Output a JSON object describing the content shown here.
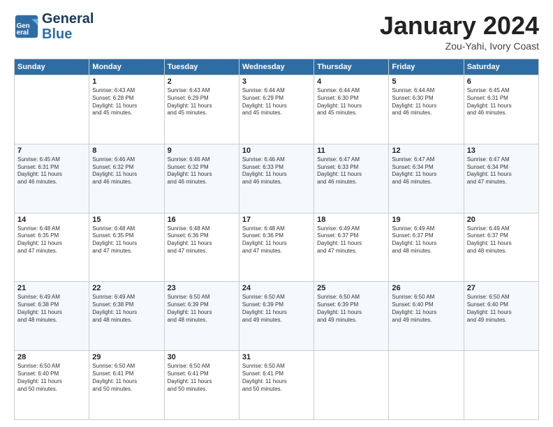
{
  "header": {
    "logo_line1": "General",
    "logo_line2": "Blue",
    "month": "January 2024",
    "location": "Zou-Yahi, Ivory Coast"
  },
  "weekdays": [
    "Sunday",
    "Monday",
    "Tuesday",
    "Wednesday",
    "Thursday",
    "Friday",
    "Saturday"
  ],
  "weeks": [
    [
      {
        "day": "",
        "content": ""
      },
      {
        "day": "1",
        "content": "Sunrise: 6:43 AM\nSunset: 6:28 PM\nDaylight: 11 hours\nand 45 minutes."
      },
      {
        "day": "2",
        "content": "Sunrise: 6:43 AM\nSunset: 6:29 PM\nDaylight: 11 hours\nand 45 minutes."
      },
      {
        "day": "3",
        "content": "Sunrise: 6:44 AM\nSunset: 6:29 PM\nDaylight: 11 hours\nand 45 minutes."
      },
      {
        "day": "4",
        "content": "Sunrise: 6:44 AM\nSunset: 6:30 PM\nDaylight: 11 hours\nand 45 minutes."
      },
      {
        "day": "5",
        "content": "Sunrise: 6:44 AM\nSunset: 6:30 PM\nDaylight: 11 hours\nand 46 minutes."
      },
      {
        "day": "6",
        "content": "Sunrise: 6:45 AM\nSunset: 6:31 PM\nDaylight: 11 hours\nand 46 minutes."
      }
    ],
    [
      {
        "day": "7",
        "content": "Sunrise: 6:45 AM\nSunset: 6:31 PM\nDaylight: 11 hours\nand 46 minutes."
      },
      {
        "day": "8",
        "content": "Sunrise: 6:46 AM\nSunset: 6:32 PM\nDaylight: 11 hours\nand 46 minutes."
      },
      {
        "day": "9",
        "content": "Sunrise: 6:46 AM\nSunset: 6:32 PM\nDaylight: 11 hours\nand 46 minutes."
      },
      {
        "day": "10",
        "content": "Sunrise: 6:46 AM\nSunset: 6:33 PM\nDaylight: 11 hours\nand 46 minutes."
      },
      {
        "day": "11",
        "content": "Sunrise: 6:47 AM\nSunset: 6:33 PM\nDaylight: 11 hours\nand 46 minutes."
      },
      {
        "day": "12",
        "content": "Sunrise: 6:47 AM\nSunset: 6:34 PM\nDaylight: 11 hours\nand 46 minutes."
      },
      {
        "day": "13",
        "content": "Sunrise: 6:47 AM\nSunset: 6:34 PM\nDaylight: 11 hours\nand 47 minutes."
      }
    ],
    [
      {
        "day": "14",
        "content": "Sunrise: 6:48 AM\nSunset: 6:35 PM\nDaylight: 11 hours\nand 47 minutes."
      },
      {
        "day": "15",
        "content": "Sunrise: 6:48 AM\nSunset: 6:35 PM\nDaylight: 11 hours\nand 47 minutes."
      },
      {
        "day": "16",
        "content": "Sunrise: 6:48 AM\nSunset: 6:36 PM\nDaylight: 11 hours\nand 47 minutes."
      },
      {
        "day": "17",
        "content": "Sunrise: 6:48 AM\nSunset: 6:36 PM\nDaylight: 11 hours\nand 47 minutes."
      },
      {
        "day": "18",
        "content": "Sunrise: 6:49 AM\nSunset: 6:37 PM\nDaylight: 11 hours\nand 47 minutes."
      },
      {
        "day": "19",
        "content": "Sunrise: 6:49 AM\nSunset: 6:37 PM\nDaylight: 11 hours\nand 48 minutes."
      },
      {
        "day": "20",
        "content": "Sunrise: 6:49 AM\nSunset: 6:37 PM\nDaylight: 11 hours\nand 48 minutes."
      }
    ],
    [
      {
        "day": "21",
        "content": "Sunrise: 6:49 AM\nSunset: 6:38 PM\nDaylight: 11 hours\nand 48 minutes."
      },
      {
        "day": "22",
        "content": "Sunrise: 6:49 AM\nSunset: 6:38 PM\nDaylight: 11 hours\nand 48 minutes."
      },
      {
        "day": "23",
        "content": "Sunrise: 6:50 AM\nSunset: 6:39 PM\nDaylight: 11 hours\nand 48 minutes."
      },
      {
        "day": "24",
        "content": "Sunrise: 6:50 AM\nSunset: 6:39 PM\nDaylight: 11 hours\nand 49 minutes."
      },
      {
        "day": "25",
        "content": "Sunrise: 6:50 AM\nSunset: 6:39 PM\nDaylight: 11 hours\nand 49 minutes."
      },
      {
        "day": "26",
        "content": "Sunrise: 6:50 AM\nSunset: 6:40 PM\nDaylight: 11 hours\nand 49 minutes."
      },
      {
        "day": "27",
        "content": "Sunrise: 6:50 AM\nSunset: 6:40 PM\nDaylight: 11 hours\nand 49 minutes."
      }
    ],
    [
      {
        "day": "28",
        "content": "Sunrise: 6:50 AM\nSunset: 6:40 PM\nDaylight: 11 hours\nand 50 minutes."
      },
      {
        "day": "29",
        "content": "Sunrise: 6:50 AM\nSunset: 6:41 PM\nDaylight: 11 hours\nand 50 minutes."
      },
      {
        "day": "30",
        "content": "Sunrise: 6:50 AM\nSunset: 6:41 PM\nDaylight: 11 hours\nand 50 minutes."
      },
      {
        "day": "31",
        "content": "Sunrise: 6:50 AM\nSunset: 6:41 PM\nDaylight: 11 hours\nand 50 minutes."
      },
      {
        "day": "",
        "content": ""
      },
      {
        "day": "",
        "content": ""
      },
      {
        "day": "",
        "content": ""
      }
    ]
  ]
}
